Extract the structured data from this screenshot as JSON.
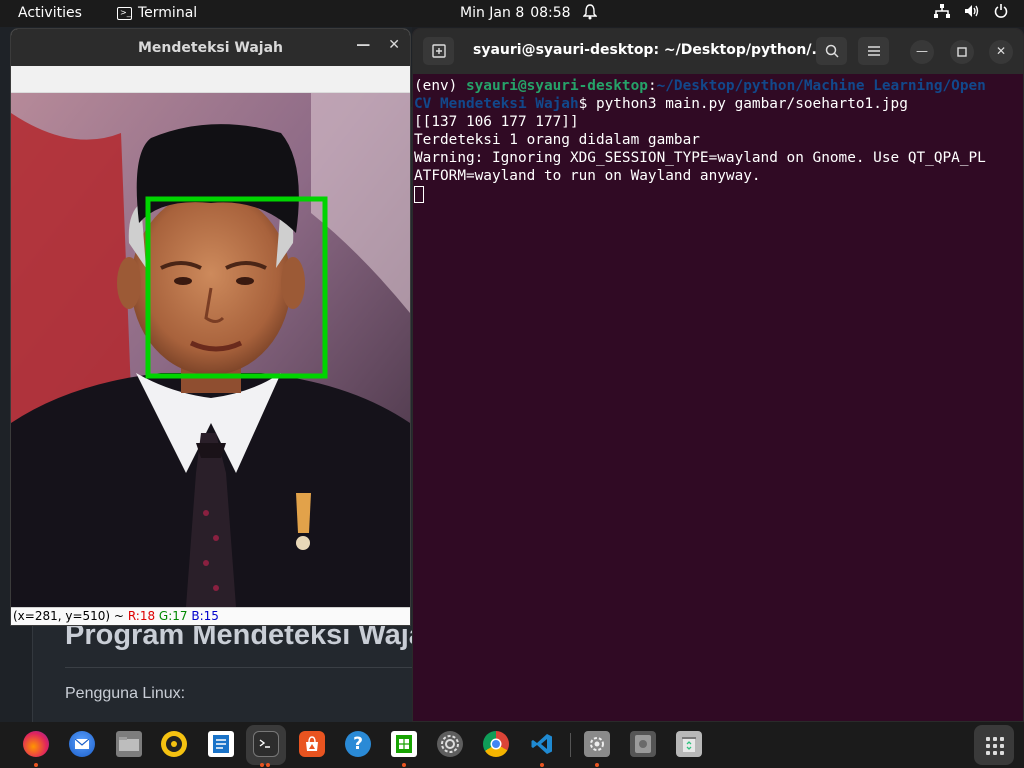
{
  "topbar": {
    "activities": "Activities",
    "app_name": "Terminal",
    "date": "Min Jan 8",
    "time": "08:58"
  },
  "background_page": {
    "heading": "Program Mendeteksi Wajah",
    "paragraph": "Pengguna Linux:"
  },
  "cv_window": {
    "title": "Mendeteksi Wajah",
    "status_coords": "(x=281, y=510) ~",
    "status_r": "R:18",
    "status_g": "G:17",
    "status_b": "B:15",
    "face_box_color": "#00d400"
  },
  "terminal": {
    "title": "syauri@syauri-desktop: ~/Desktop/python/...",
    "prompt_env": "(env) ",
    "prompt_user": "syauri@syauri-desktop",
    "prompt_sep": ":",
    "prompt_path_1": "~/Desktop/python/Machine Learning/Open",
    "prompt_path_2": "CV Mendeteksi Wajah",
    "command": "$ python3 main.py gambar/soeharto1.jpg",
    "output": [
      "[[137 106 177 177]]",
      "Terdeteksi 1 orang didalam gambar",
      "Warning: Ignoring XDG_SESSION_TYPE=wayland on Gnome. Use QT_QPA_PL",
      "ATFORM=wayland to run on Wayland anyway."
    ]
  },
  "dock": {
    "items": [
      "firefox-icon",
      "thunderbird-icon",
      "files-icon",
      "rhythmbox-icon",
      "writer-icon",
      "terminal-icon",
      "software-icon",
      "help-icon",
      "calc-icon",
      "settings-icon",
      "chrome-icon",
      "vscode-icon",
      "update-icon",
      "disk-icon",
      "trash-icon"
    ]
  },
  "colors": {
    "terminal_bg": "#300a24",
    "prompt_user": "#26a269",
    "prompt_path": "#12488b",
    "accent": "#e95420"
  }
}
